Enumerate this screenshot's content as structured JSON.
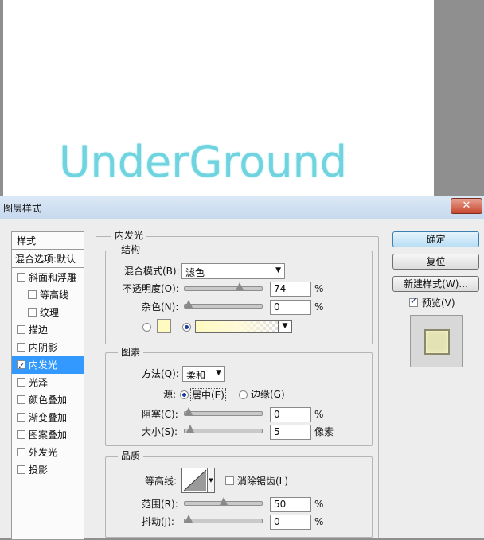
{
  "canvas": {
    "text": "UnderGround"
  },
  "dialog": {
    "title": "图层样式",
    "close": "✕",
    "left_panel": {
      "header": "样式",
      "blend_options": "混合选项:默认",
      "items": [
        {
          "label": "斜面和浮雕",
          "checked": false,
          "indent": false
        },
        {
          "label": "等高线",
          "checked": false,
          "indent": true
        },
        {
          "label": "纹理",
          "checked": false,
          "indent": true
        },
        {
          "label": "描边",
          "checked": false,
          "indent": false
        },
        {
          "label": "内阴影",
          "checked": false,
          "indent": false
        },
        {
          "label": "内发光",
          "checked": true,
          "indent": false,
          "selected": true
        },
        {
          "label": "光泽",
          "checked": false,
          "indent": false
        },
        {
          "label": "颜色叠加",
          "checked": false,
          "indent": false
        },
        {
          "label": "渐变叠加",
          "checked": false,
          "indent": false
        },
        {
          "label": "图案叠加",
          "checked": false,
          "indent": false
        },
        {
          "label": "外发光",
          "checked": false,
          "indent": false
        },
        {
          "label": "投影",
          "checked": false,
          "indent": false
        }
      ]
    },
    "inner_glow": {
      "title": "内发光",
      "structure": {
        "title": "结构",
        "blend_mode_label": "混合模式(B):",
        "blend_mode_value": "滤色",
        "opacity_label": "不透明度(O):",
        "opacity_value": "74",
        "opacity_level": 74,
        "noise_label": "杂色(N):",
        "noise_value": "0",
        "noise_level": 0,
        "percent": "%",
        "solid_color": "#fffac0"
      },
      "elements": {
        "title": "图素",
        "technique_label": "方法(Q):",
        "technique_value": "柔和",
        "source_label": "源:",
        "source_center": "居中(E)",
        "source_edge": "边缘(G)",
        "choke_label": "阻塞(C):",
        "choke_value": "0",
        "choke_level": 0,
        "size_label": "大小(S):",
        "size_value": "5",
        "size_unit": "像素",
        "percent": "%"
      },
      "quality": {
        "title": "品质",
        "contour_label": "等高线:",
        "antialias_label": "消除锯齿(L)",
        "range_label": "范围(R):",
        "range_value": "50",
        "range_level": 50,
        "jitter_label": "抖动(J):",
        "jitter_value": "0",
        "jitter_level": 0,
        "percent": "%"
      }
    },
    "buttons": {
      "ok": "确定",
      "reset": "复位",
      "new_style": "新建样式(W)...",
      "preview": "预览(V)"
    }
  }
}
